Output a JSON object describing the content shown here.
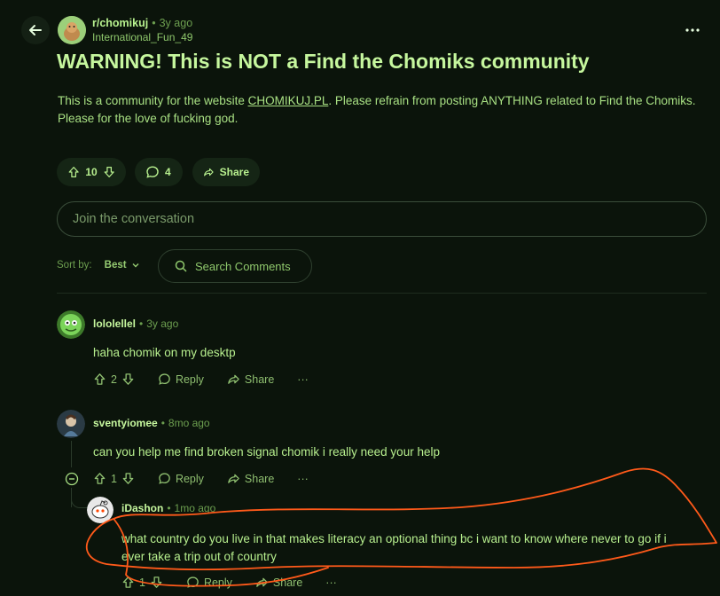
{
  "post": {
    "subreddit": "r/chomikuj",
    "age": "3y ago",
    "author": "International_Fun_49",
    "title": "WARNING! This is NOT a Find the Chomiks community",
    "body_pre": "This is a community for the website ",
    "body_link": "CHOMIKUJ.PL",
    "body_post": ". Please refrain from posting ANYTHING related to Find the Chomiks.",
    "body_line2": "Please for the love of fucking god.",
    "votes": "10",
    "comments": "4",
    "share_label": "Share",
    "separator": "•"
  },
  "composer": {
    "placeholder": "Join the conversation"
  },
  "sort": {
    "label": "Sort by:",
    "value": "Best",
    "search_placeholder": "Search Comments"
  },
  "comments": [
    {
      "author": "lololellel",
      "age": "3y ago",
      "text": "haha chomik on my desktp",
      "votes": "2",
      "reply": "Reply",
      "share": "Share",
      "more": "···"
    },
    {
      "author": "sventyiomee",
      "age": "8mo ago",
      "text": "can you help me find broken signal chomik i really need your help",
      "votes": "1",
      "reply": "Reply",
      "share": "Share",
      "more": "···"
    },
    {
      "author": "iDashon",
      "age": "1mo ago",
      "text_line1": "what country do you live in that makes literacy an optional thing bc i want to know where never to go if i",
      "text_line2": "ever take a trip out of country",
      "votes": "1",
      "reply": "Reply",
      "share": "Share",
      "more": "···"
    }
  ],
  "colors": {
    "background": "#0b140b",
    "accent": "#a3e27d",
    "annotation": "#ff5a1a"
  }
}
